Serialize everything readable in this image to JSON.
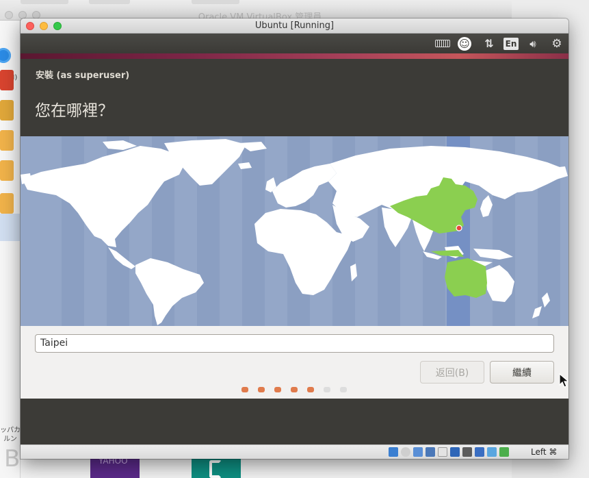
{
  "background_window": {
    "title": "Oracle VM VirtualBox 管理員",
    "new_label": "增(N)",
    "side_text": "ッパカルン"
  },
  "vm_window": {
    "title": "Ubuntu [Running]",
    "host_key": "Left ⌘"
  },
  "ubuntu_panel": {
    "language_indicator": "En",
    "icons": [
      "keyboard-icon",
      "accessibility-icon",
      "network-icon",
      "language-icon",
      "volume-icon",
      "power-icon"
    ]
  },
  "installer": {
    "title": "安裝 (as superuser)",
    "question": "您在哪裡？",
    "location_value": "Taipei",
    "back_button": "返回(B)",
    "continue_button": "繼續",
    "progress": {
      "total_steps": 7,
      "current_step": 5
    },
    "selected_timezone_region": "Asia/Taipei"
  },
  "colors": {
    "ubuntu_dark": "#3c3b37",
    "map_ocean": "#94a7c8",
    "map_land": "#ffffff",
    "selected_country": "#8bcf50",
    "timezone_highlight": "#7590c4",
    "progress_done": "#e07b4c",
    "progress_todo": "#dddddd"
  }
}
